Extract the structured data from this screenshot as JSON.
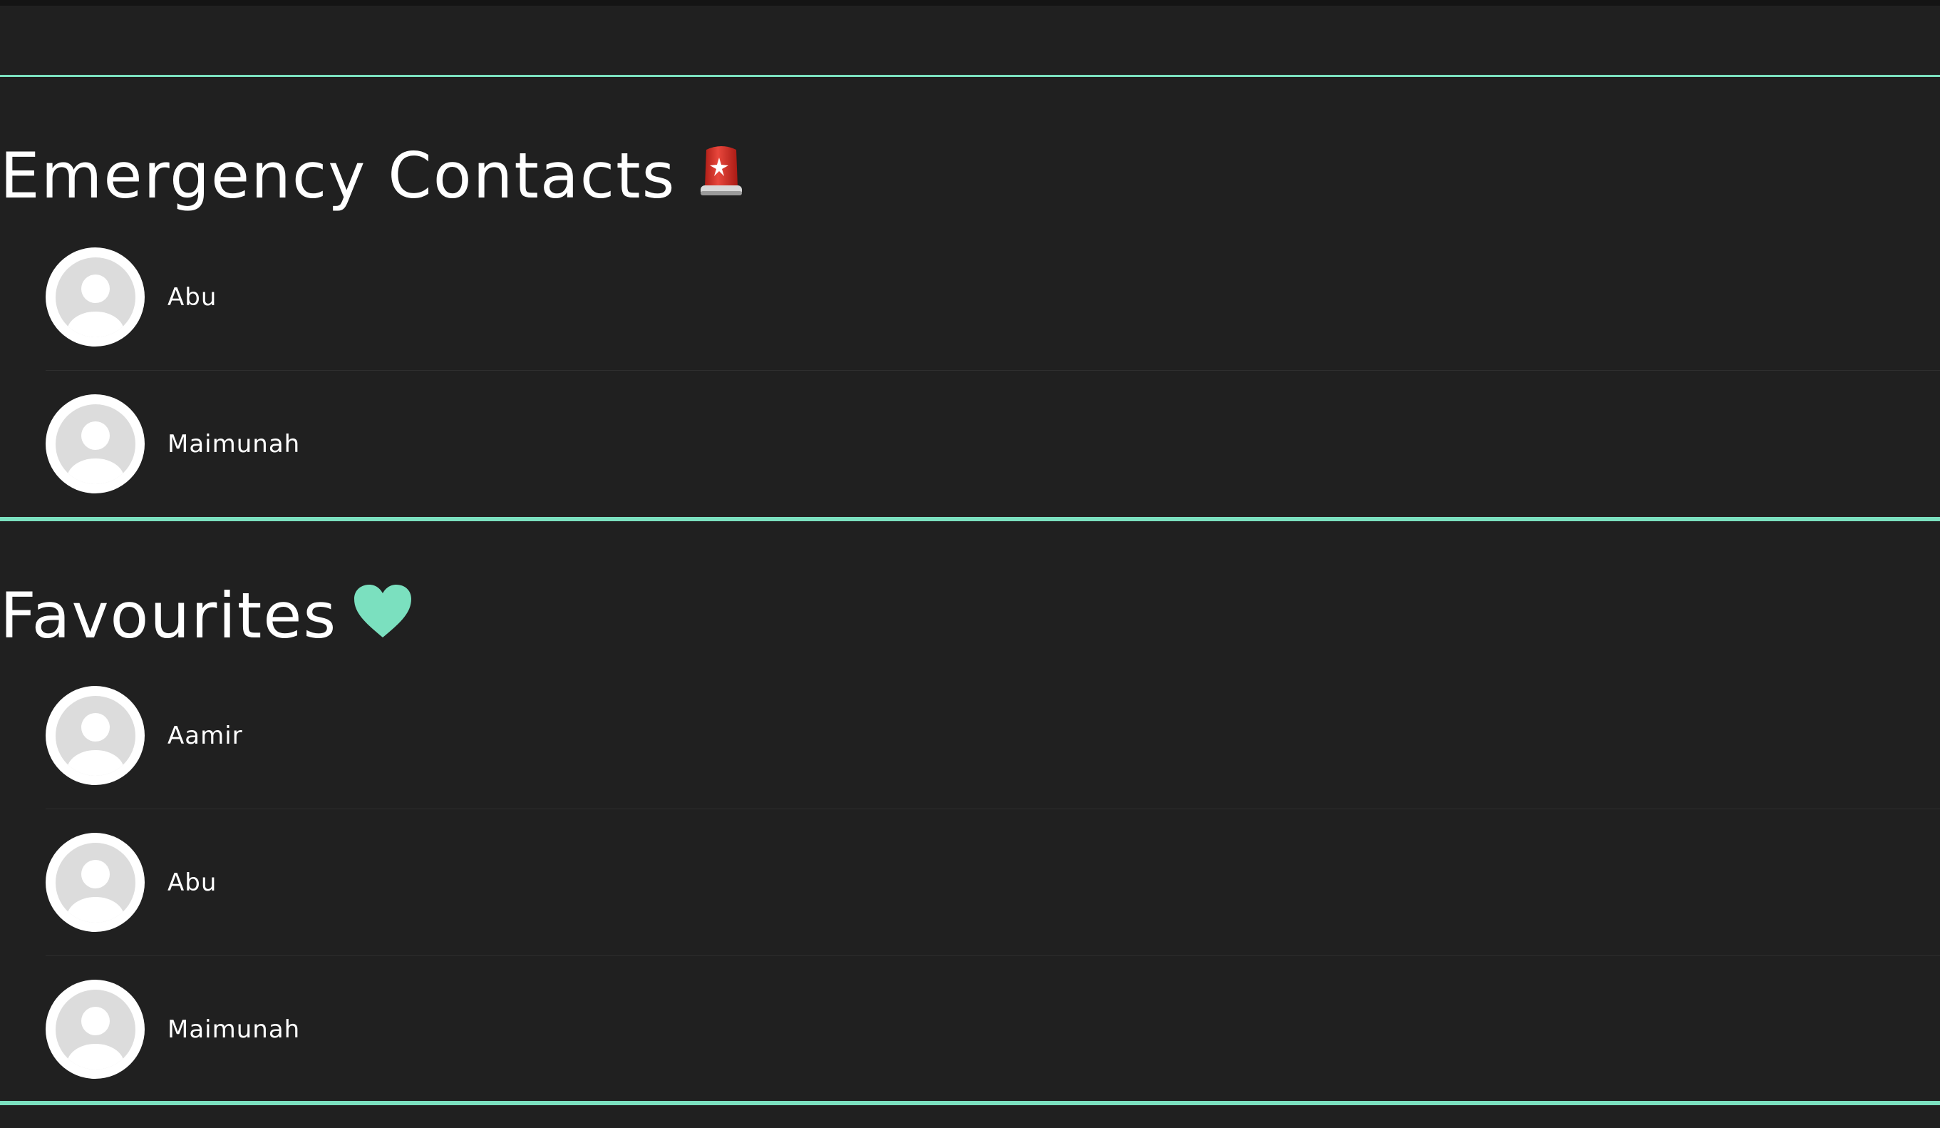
{
  "sections": {
    "emergency": {
      "title": "Emergency Contacts",
      "icon": "police-siren-icon",
      "contacts": [
        {
          "name": "Abu"
        },
        {
          "name": "Maimunah"
        }
      ]
    },
    "favourites": {
      "title": "Favourites",
      "icon": "heart-icon",
      "contacts": [
        {
          "name": "Aamir"
        },
        {
          "name": "Abu"
        },
        {
          "name": "Maimunah"
        }
      ]
    }
  },
  "colors": {
    "background": "#202020",
    "accent": "#7be0bf",
    "siren": "#e0352b",
    "avatar_placeholder": "#dcdcdc"
  }
}
